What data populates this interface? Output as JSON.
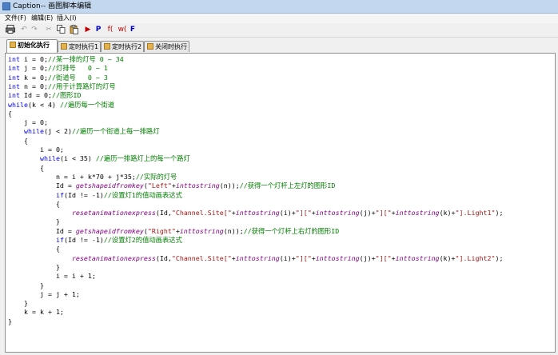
{
  "window": {
    "title": "Caption-- 画图脚本编辑"
  },
  "menu": {
    "items": [
      "文件(F)",
      "编辑(E)",
      "插入(I)"
    ]
  },
  "toolbar": {
    "run_label": "▶",
    "p_label": "P",
    "fx_label": "f(",
    "wx_label": "w(",
    "f_label": "F"
  },
  "tabs": [
    {
      "label": "初始化执行",
      "active": true
    },
    {
      "label": "定时执行1",
      "active": false
    },
    {
      "label": "定时执行2",
      "active": false
    },
    {
      "label": "关闭时执行",
      "active": false
    }
  ],
  "code_lines": [
    [
      {
        "t": "int",
        "c": "kw"
      },
      {
        "t": " i = 0;"
      },
      {
        "t": "//某一排的灯号 0 ~ 34",
        "c": "cm"
      }
    ],
    [
      {
        "t": "int",
        "c": "kw"
      },
      {
        "t": " j = 0;"
      },
      {
        "t": "//灯排号   0 ~ 1",
        "c": "cm"
      }
    ],
    [
      {
        "t": "int",
        "c": "kw"
      },
      {
        "t": " k = 0;"
      },
      {
        "t": "//街道号   0 ~ 3",
        "c": "cm"
      }
    ],
    [
      {
        "t": "int",
        "c": "kw"
      },
      {
        "t": " n = 0;"
      },
      {
        "t": "//用于计算路灯的灯号",
        "c": "cm"
      }
    ],
    [
      {
        "t": "int",
        "c": "kw"
      },
      {
        "t": " Id = 0;"
      },
      {
        "t": "//图形ID",
        "c": "cm"
      }
    ],
    [
      {
        "t": "while",
        "c": "kw"
      },
      {
        "t": "(k < 4) "
      },
      {
        "t": "//遍历每一个街道",
        "c": "cm"
      }
    ],
    [
      {
        "t": "{"
      }
    ],
    [
      {
        "t": "    j = 0;"
      }
    ],
    [
      {
        "t": "    "
      },
      {
        "t": "while",
        "c": "kw"
      },
      {
        "t": "(j < 2)"
      },
      {
        "t": "//遍历一个街道上每一排路灯",
        "c": "cm"
      }
    ],
    [
      {
        "t": "    {"
      }
    ],
    [
      {
        "t": "        i = 0;"
      }
    ],
    [
      {
        "t": "        "
      },
      {
        "t": "while",
        "c": "kw"
      },
      {
        "t": "(i < 35) "
      },
      {
        "t": "//遍历一排路灯上的每一个路灯",
        "c": "cm"
      }
    ],
    [
      {
        "t": "        {"
      }
    ],
    [
      {
        "t": "            n = i + k*70 + j*35;"
      },
      {
        "t": "//实际的灯号",
        "c": "cm"
      }
    ],
    [
      {
        "t": "            Id = "
      },
      {
        "t": "getshapeidfromkey",
        "c": "fn"
      },
      {
        "t": "("
      },
      {
        "t": "\"Left\"",
        "c": "st"
      },
      {
        "t": "+"
      },
      {
        "t": "inttostring",
        "c": "fn"
      },
      {
        "t": "(n));"
      },
      {
        "t": "//获得一个灯杆上左灯的图形ID",
        "c": "cm"
      }
    ],
    [
      {
        "t": "            "
      },
      {
        "t": "if",
        "c": "kw"
      },
      {
        "t": "(Id != -1)"
      },
      {
        "t": "//设置灯1的值动画表达式",
        "c": "cm"
      }
    ],
    [
      {
        "t": "            {"
      }
    ],
    [
      {
        "t": "                "
      },
      {
        "t": "resetanimationexpress",
        "c": "fn"
      },
      {
        "t": "(Id,"
      },
      {
        "t": "\"Channel.Site[\"",
        "c": "st"
      },
      {
        "t": "+"
      },
      {
        "t": "inttostring",
        "c": "fn"
      },
      {
        "t": "(i)+"
      },
      {
        "t": "\"][\"",
        "c": "st"
      },
      {
        "t": "+"
      },
      {
        "t": "inttostring",
        "c": "fn"
      },
      {
        "t": "(j)+"
      },
      {
        "t": "\"][\"",
        "c": "st"
      },
      {
        "t": "+"
      },
      {
        "t": "inttostring",
        "c": "fn"
      },
      {
        "t": "(k)+"
      },
      {
        "t": "\"].Light1\"",
        "c": "st"
      },
      {
        "t": ");"
      }
    ],
    [
      {
        "t": "            }"
      }
    ],
    [
      {
        "t": "            Id = "
      },
      {
        "t": "getshapeidfromkey",
        "c": "fn"
      },
      {
        "t": "("
      },
      {
        "t": "\"Right\"",
        "c": "st"
      },
      {
        "t": "+"
      },
      {
        "t": "inttostring",
        "c": "fn"
      },
      {
        "t": "(n));"
      },
      {
        "t": "//获得一个灯杆上右灯的图形ID",
        "c": "cm"
      }
    ],
    [
      {
        "t": "            "
      },
      {
        "t": "if",
        "c": "kw"
      },
      {
        "t": "(Id != -1)"
      },
      {
        "t": "//设置灯2的值动画表达式",
        "c": "cm"
      }
    ],
    [
      {
        "t": "            {"
      }
    ],
    [
      {
        "t": "                "
      },
      {
        "t": "resetanimationexpress",
        "c": "fn"
      },
      {
        "t": "(Id,"
      },
      {
        "t": "\"Channel.Site[\"",
        "c": "st"
      },
      {
        "t": "+"
      },
      {
        "t": "inttostring",
        "c": "fn"
      },
      {
        "t": "(i)+"
      },
      {
        "t": "\"][\"",
        "c": "st"
      },
      {
        "t": "+"
      },
      {
        "t": "inttostring",
        "c": "fn"
      },
      {
        "t": "(j)+"
      },
      {
        "t": "\"][\"",
        "c": "st"
      },
      {
        "t": "+"
      },
      {
        "t": "inttostring",
        "c": "fn"
      },
      {
        "t": "(k)+"
      },
      {
        "t": "\"].Light2\"",
        "c": "st"
      },
      {
        "t": ");"
      }
    ],
    [
      {
        "t": "            }"
      }
    ],
    [
      {
        "t": "            i = i + 1;"
      }
    ],
    [
      {
        "t": "        }"
      }
    ],
    [
      {
        "t": "        j = j + 1;"
      }
    ],
    [
      {
        "t": "    }"
      }
    ],
    [
      {
        "t": "    k = k + 1;"
      }
    ],
    [
      {
        "t": "}"
      }
    ]
  ]
}
